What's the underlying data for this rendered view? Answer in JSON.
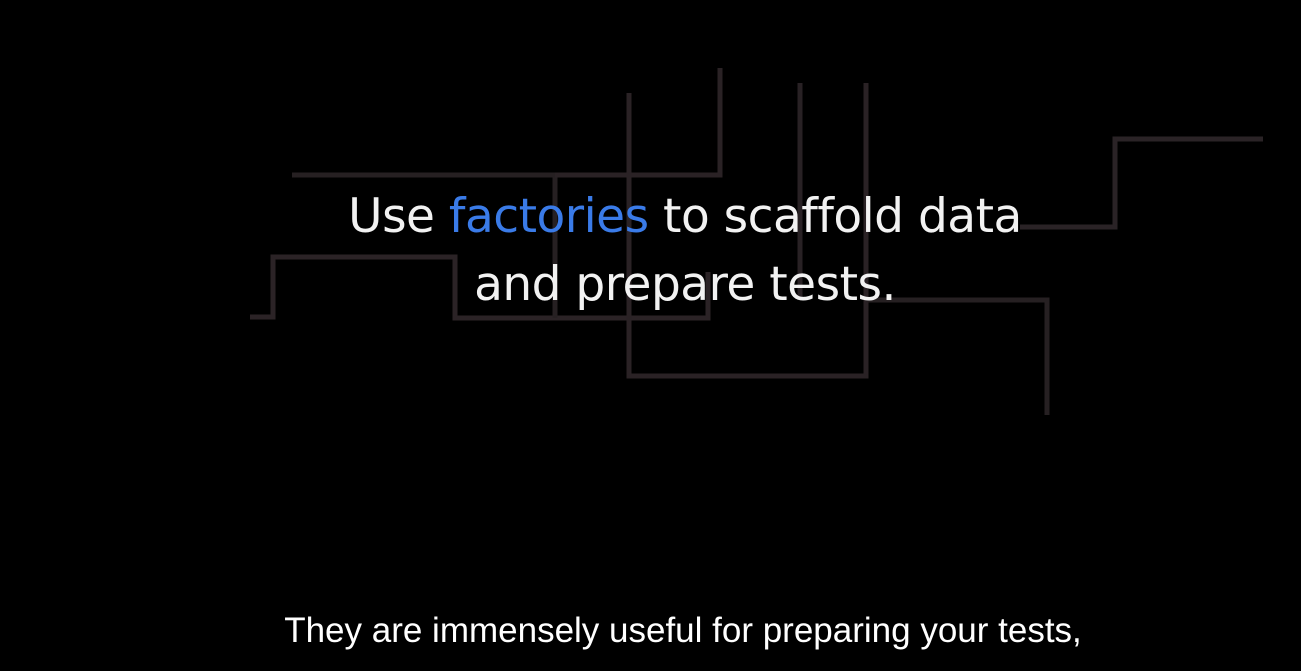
{
  "slide": {
    "line1_before": "Use ",
    "line1_accent": "factories",
    "line1_after": " to scaffold data",
    "line2": "and prepare tests.",
    "accent_color": "#3a7be8",
    "text_color": "#f2f2f2",
    "background_color": "#000000"
  },
  "subtitles": {
    "text": "They are immensely useful for preparing your tests,"
  }
}
